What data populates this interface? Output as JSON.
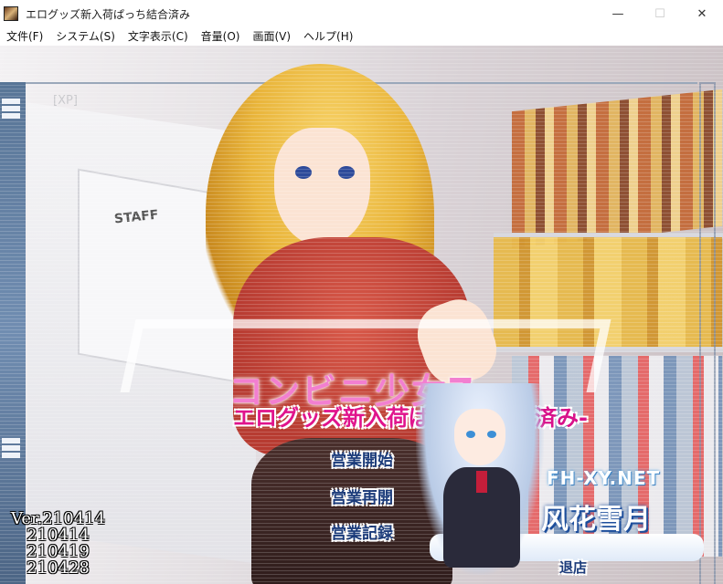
{
  "window": {
    "title": "エログッズ新入荷ぱっち結合済み",
    "controls": {
      "minimize": "—",
      "maximize": "☐",
      "close": "✕"
    }
  },
  "menu": [
    "文件(F)",
    "システム(S)",
    "文字表示(C)",
    "音量(O)",
    "画面(V)",
    "ヘルプ(H)"
  ],
  "game": {
    "xp_label": "[XP]",
    "staff_sign": "STAFF",
    "logo": {
      "line1": "コンビニ少女Z",
      "line2": "エログッズ新入荷ぱっち",
      "line2_sub": "-結合済み-"
    },
    "options": {
      "start": "営業開始",
      "resume": "営業再開",
      "records": "営業記録",
      "quit": "退店"
    },
    "version_lines": [
      "Ver.210414",
      "   210414",
      "   210419",
      "   210428"
    ],
    "watermark": {
      "site": "FH-XY.NET",
      "name": "风花雪月"
    }
  },
  "colors": {
    "logo_pink": "#f27fd0",
    "logo_magenta": "#e0148c",
    "option_text": "#1b3b7a"
  }
}
